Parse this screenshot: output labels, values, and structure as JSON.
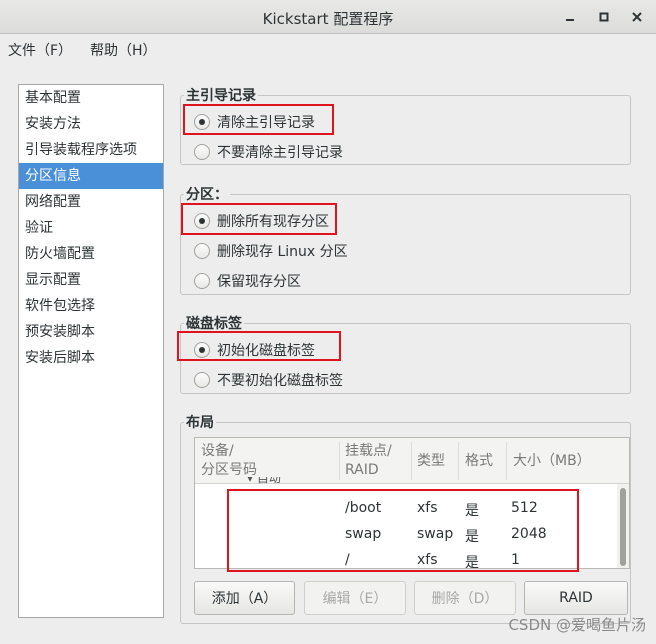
{
  "window": {
    "title": "Kickstart 配置程序",
    "min_icon": "minimize-icon",
    "max_icon": "maximize-icon",
    "close_icon": "close-icon"
  },
  "menu": [
    "文件（F）",
    "帮助（H）"
  ],
  "sidebar": {
    "items": [
      "基本配置",
      "安装方法",
      "引导装载程序选项",
      "分区信息",
      "网络配置",
      "验证",
      "防火墙配置",
      "显示配置",
      "软件包选择",
      "预安装脚本",
      "安装后脚本"
    ],
    "selected_index": 3
  },
  "mbr": {
    "title": "主引导记录",
    "options": [
      "清除主引导记录",
      "不要清除主引导记录"
    ],
    "selected_index": 0
  },
  "partition": {
    "title": "分区：",
    "options": [
      "删除所有现存分区",
      "删除现存  Linux 分区",
      "保留现存分区"
    ],
    "selected_index": 0
  },
  "disklabel": {
    "title": "磁盘标签",
    "options": [
      "初始化磁盘标签",
      "不要初始化磁盘标签"
    ],
    "selected_index": 0
  },
  "layout": {
    "title": "布局",
    "headers": {
      "device_1": "设备/",
      "device_2": "分区号码",
      "mount_1": "挂载点/",
      "mount_2": "RAID",
      "type": "类型",
      "format": "格式",
      "size": "大小（MB）"
    },
    "partial_row": "自动",
    "rows": [
      {
        "mount": "/boot",
        "type": "xfs",
        "format": "是",
        "size": "512"
      },
      {
        "mount": "swap",
        "type": "swap",
        "format": "是",
        "size": "2048"
      },
      {
        "mount": "/",
        "type": "xfs",
        "format": "是",
        "size": "1"
      }
    ]
  },
  "buttons": {
    "add": "添加（A）",
    "edit": "编辑（E）",
    "delete": "删除（D）",
    "raid": "RAID"
  },
  "watermark": "CSDN @爱喝鱼片汤",
  "colors": {
    "selection": "#4a90d9",
    "highlight_box": "#e0141e"
  }
}
